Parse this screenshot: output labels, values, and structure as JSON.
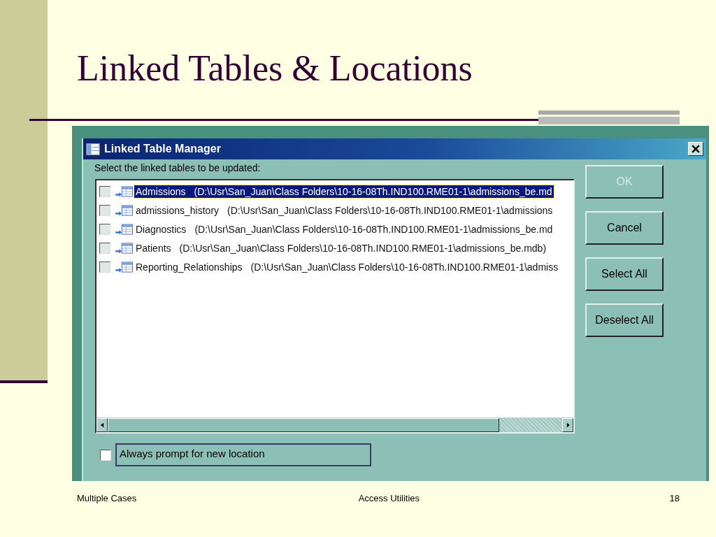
{
  "slide": {
    "title": "Linked Tables & Locations"
  },
  "dialog": {
    "title": "Linked Table Manager",
    "prompt": "Select the linked tables to be updated:",
    "tables": [
      {
        "name": "Admissions",
        "path": "(D:\\Usr\\San_Juan\\Class Folders\\10-16-08Th.IND100.RME01-1\\admissions_be.md",
        "checked": false,
        "selected": true
      },
      {
        "name": "admissions_history",
        "path": "(D:\\Usr\\San_Juan\\Class Folders\\10-16-08Th.IND100.RME01-1\\admissions",
        "checked": false,
        "selected": false
      },
      {
        "name": "Diagnostics",
        "path": "(D:\\Usr\\San_Juan\\Class Folders\\10-16-08Th.IND100.RME01-1\\admissions_be.md",
        "checked": false,
        "selected": false
      },
      {
        "name": "Patients",
        "path": "(D:\\Usr\\San_Juan\\Class Folders\\10-16-08Th.IND100.RME01-1\\admissions_be.mdb)",
        "checked": false,
        "selected": false
      },
      {
        "name": "Reporting_Relationships",
        "path": "(D:\\Usr\\San_Juan\\Class Folders\\10-16-08Th.IND100.RME01-1\\admiss",
        "checked": false,
        "selected": false
      }
    ],
    "buttons": [
      {
        "label": "OK",
        "disabled": true
      },
      {
        "label": "Cancel",
        "disabled": false
      },
      {
        "label": "Select All",
        "disabled": false
      },
      {
        "label": "Deselect All",
        "disabled": false
      }
    ],
    "always_prompt": {
      "label": "Always prompt for new location",
      "checked": false
    }
  },
  "footer": {
    "left": "Multiple Cases",
    "center": "Access Utilities",
    "page": "18"
  }
}
